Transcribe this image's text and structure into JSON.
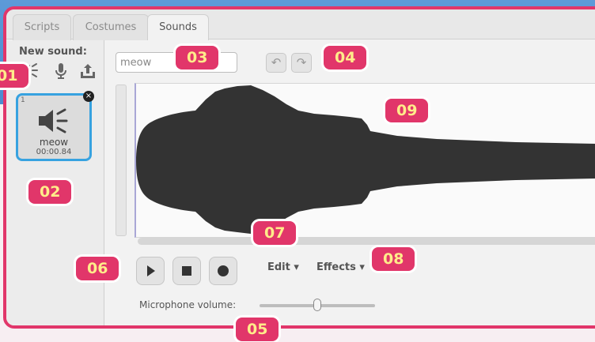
{
  "tabs": [
    {
      "label": "Scripts"
    },
    {
      "label": "Costumes"
    },
    {
      "label": "Sounds"
    }
  ],
  "sidebar": {
    "new_sound_label": "New sound:",
    "new_sound_icons": [
      "speaker-library-icon",
      "microphone-icon",
      "upload-icon"
    ],
    "sound_item": {
      "index": "1",
      "name": "meow",
      "duration": "00:00.84"
    }
  },
  "editor": {
    "sound_name_value": "meow",
    "undo_icon": "undo-icon",
    "redo_icon": "redo-icon",
    "edit_menu": "Edit ▾",
    "effects_menu": "Effects ▾",
    "microphone_label": "Microphone volume:",
    "microphone_volume": 0.5
  },
  "annotations": [
    {
      "label": "01"
    },
    {
      "label": "02"
    },
    {
      "label": "03"
    },
    {
      "label": "04"
    },
    {
      "label": "05"
    },
    {
      "label": "06"
    },
    {
      "label": "07"
    },
    {
      "label": "08"
    },
    {
      "label": "09"
    }
  ],
  "colors": {
    "accent_frame": "#e1366a",
    "badge_text": "#ffec8a",
    "selected_border": "#37a2e0",
    "waveform": "#333333",
    "background_blue": "#4b8bd0"
  }
}
